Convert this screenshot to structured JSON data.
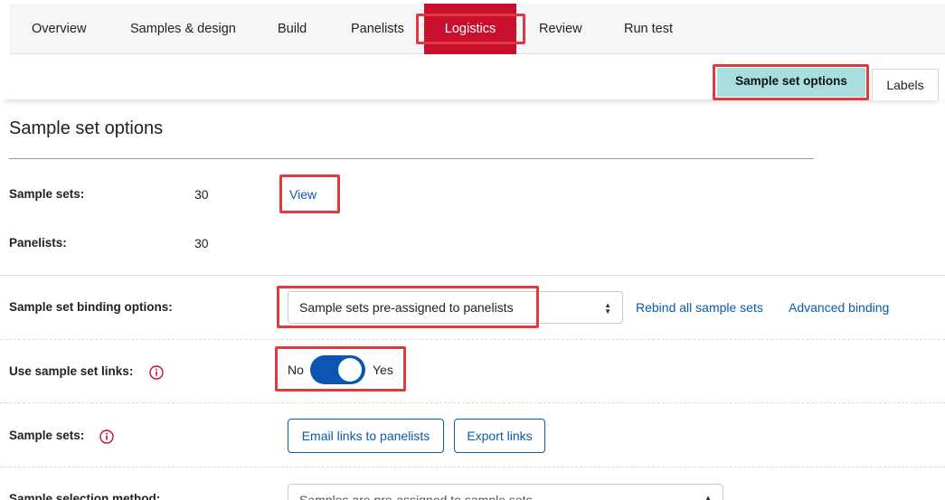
{
  "nav": {
    "tabs": [
      {
        "label": "Overview"
      },
      {
        "label": "Samples & design"
      },
      {
        "label": "Build"
      },
      {
        "label": "Panelists"
      },
      {
        "label": "Logistics"
      },
      {
        "label": "Review"
      },
      {
        "label": "Run test"
      }
    ],
    "active_color": "#c8102e"
  },
  "subtabs": {
    "active": "Sample set options",
    "other": "Labels"
  },
  "page": {
    "title": "Sample set options"
  },
  "summary": {
    "sample_sets_label": "Sample sets:",
    "sample_sets_value": "30",
    "view_link": "View",
    "panelists_label": "Panelists:",
    "panelists_value": "30"
  },
  "binding": {
    "label": "Sample set binding options:",
    "selected": "Sample sets pre-assigned to panelists",
    "rebind_link": "Rebind all sample sets",
    "advanced_link": "Advanced binding"
  },
  "links_setting": {
    "label": "Use sample set links:",
    "off_label": "No",
    "on_label": "Yes",
    "enabled": true
  },
  "sample_sets_row": {
    "label": "Sample sets:",
    "email_button": "Email links to panelists",
    "export_button": "Export links"
  },
  "selection": {
    "label": "Sample selection method:",
    "selected": "Samples are pre-assigned to sample sets"
  },
  "colors": {
    "accent_teal": "#a8dedd",
    "link_blue": "#0a5aa8",
    "highlight_red": "#e0393e",
    "info_red": "#c8102e"
  }
}
